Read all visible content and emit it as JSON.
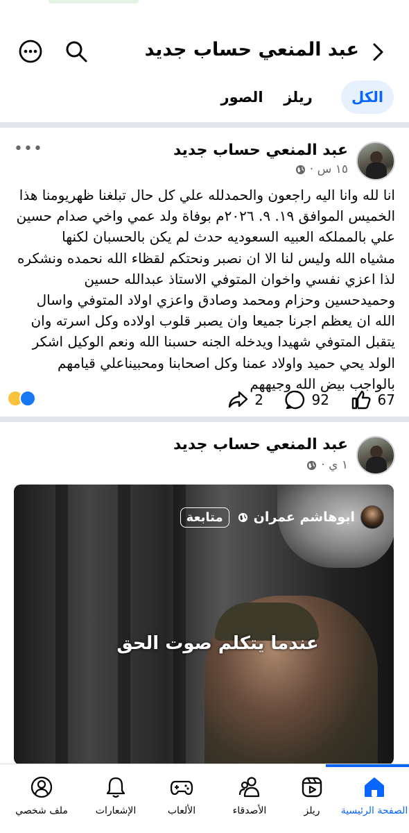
{
  "header": {
    "title": "عبد المنعي حساب جديد"
  },
  "tabs": [
    {
      "label": "الكل",
      "active": true
    },
    {
      "label": "ريلز",
      "active": false
    },
    {
      "label": "الصور",
      "active": false
    }
  ],
  "post1": {
    "author": "عبد المنعي حساب جديد",
    "time": "١٥ س ·",
    "text": "انا لله وانا اليه راجعون والحمدلله علي كل حال تبلغنا ظهريومنا هذا\nالخميس الموافق ١٩. ٩. ٢٠٢٦م بوفاة ولد عمي واخي صدام حسين\nعلي بالمملكه العبيه السعوديه حدث لم يكن بالحسبان لكنها\nمشياه الله وليس لنا الا ان نصبر ونحتكم لقظاء الله نحمده ونشكره\nلذا اعزي نفسي واخوان المتوفي الاستاذ عبدالله حسين\nوحميدحسين وحزام ومحمد وصادق واعزي اولاد المتوفي واسال\nالله ان يعظم اجرنا جميعا وان يصبر قلوب اولاده وكل اسرته وان\nيتقبل المتوفي شهيدا ويدخله الجنه حسبنا الله ونعم الوكيل  اشكر\nالولد يحي حميد واولاد عمنا وكل اصحابنا ومحبيناعلي قيامهم\nبالواجب بيض الله وجيههم",
    "likes": "67",
    "comments": "92",
    "shares": "2"
  },
  "post2": {
    "author": "عبد المنعي حساب جديد",
    "time": "١ ي ·",
    "video": {
      "channel_name": "ابوهاشم عمران",
      "follow_label": "متابعة",
      "caption": "عندما يتكلم صوت الحق"
    }
  },
  "bottom_nav": [
    {
      "label": "الصفحة الرئيسية",
      "icon": "home-icon",
      "active": true
    },
    {
      "label": "ريلز",
      "icon": "reels-icon",
      "active": false
    },
    {
      "label": "الأصدقاء",
      "icon": "friends-icon",
      "active": false
    },
    {
      "label": "الألعاب",
      "icon": "gaming-icon",
      "active": false
    },
    {
      "label": "الإشعارات",
      "icon": "bell-icon",
      "active": false
    },
    {
      "label": "ملف شخصي",
      "icon": "profile-icon",
      "active": false
    }
  ],
  "colors": {
    "accent": "#0866ff",
    "tab_active_bg": "#e7f0fd",
    "muted": "#65676b",
    "separator": "#e4e6eb"
  }
}
